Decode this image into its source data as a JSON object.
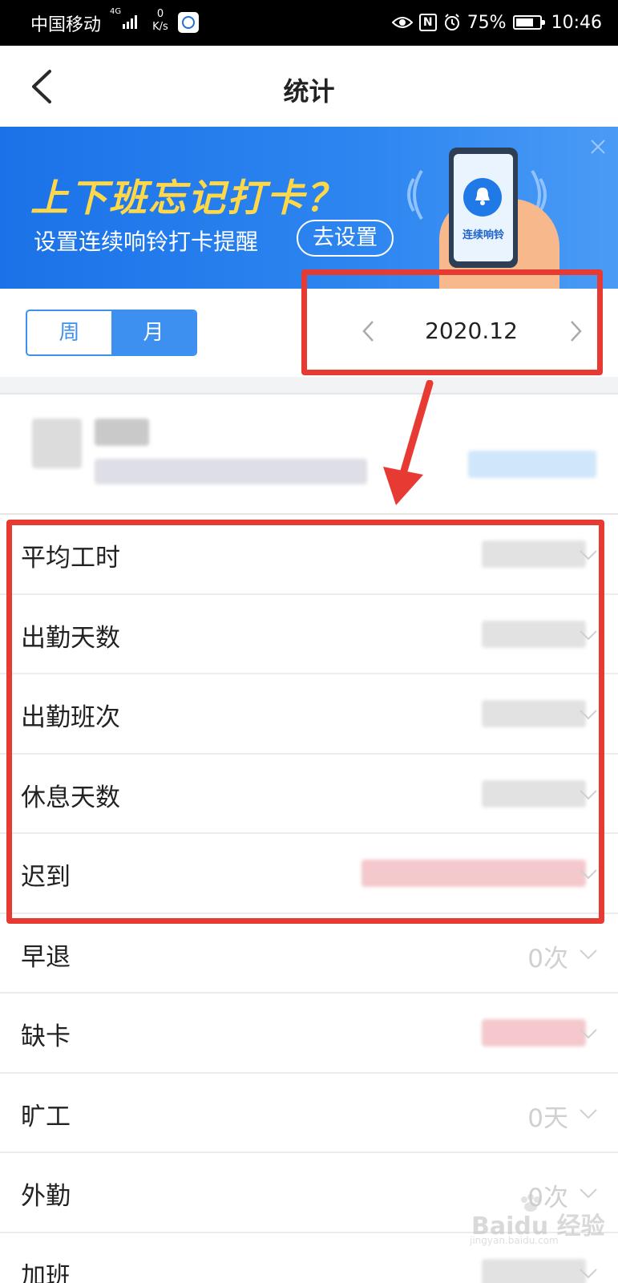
{
  "status_bar": {
    "carrier": "中国移动",
    "network": "4G",
    "speed_value": "0",
    "speed_unit": "K/s",
    "battery_percent": "75%",
    "battery_level": 0.75,
    "time": "10:46"
  },
  "header": {
    "title": "统计"
  },
  "banner": {
    "headline": "上下班忘记打卡？",
    "subtitle": "设置连续响铃打卡提醒",
    "cta": "去设置",
    "phone_label": "连续响铃"
  },
  "period_toggle": {
    "week": "周",
    "month": "月",
    "selected": "月"
  },
  "month_nav": {
    "label": "2020.12"
  },
  "stats": [
    {
      "name": "平均工时",
      "value": ""
    },
    {
      "name": "出勤天数",
      "value": ""
    },
    {
      "name": "出勤班次",
      "value": ""
    },
    {
      "name": "休息天数",
      "value": ""
    },
    {
      "name": "迟到",
      "value": ""
    },
    {
      "name": "早退",
      "value": "0次"
    },
    {
      "name": "缺卡",
      "value": ""
    },
    {
      "name": "旷工",
      "value": "0天"
    },
    {
      "name": "外勤",
      "value": "0次"
    },
    {
      "name": "加班",
      "value": ""
    }
  ],
  "watermark": {
    "text": "Baidu 经验",
    "sub": "jingyan.baidu.com"
  },
  "colors": {
    "primary": "#3d8ff0",
    "annotation": "#e63a32",
    "banner_headline": "#ffd84a"
  }
}
